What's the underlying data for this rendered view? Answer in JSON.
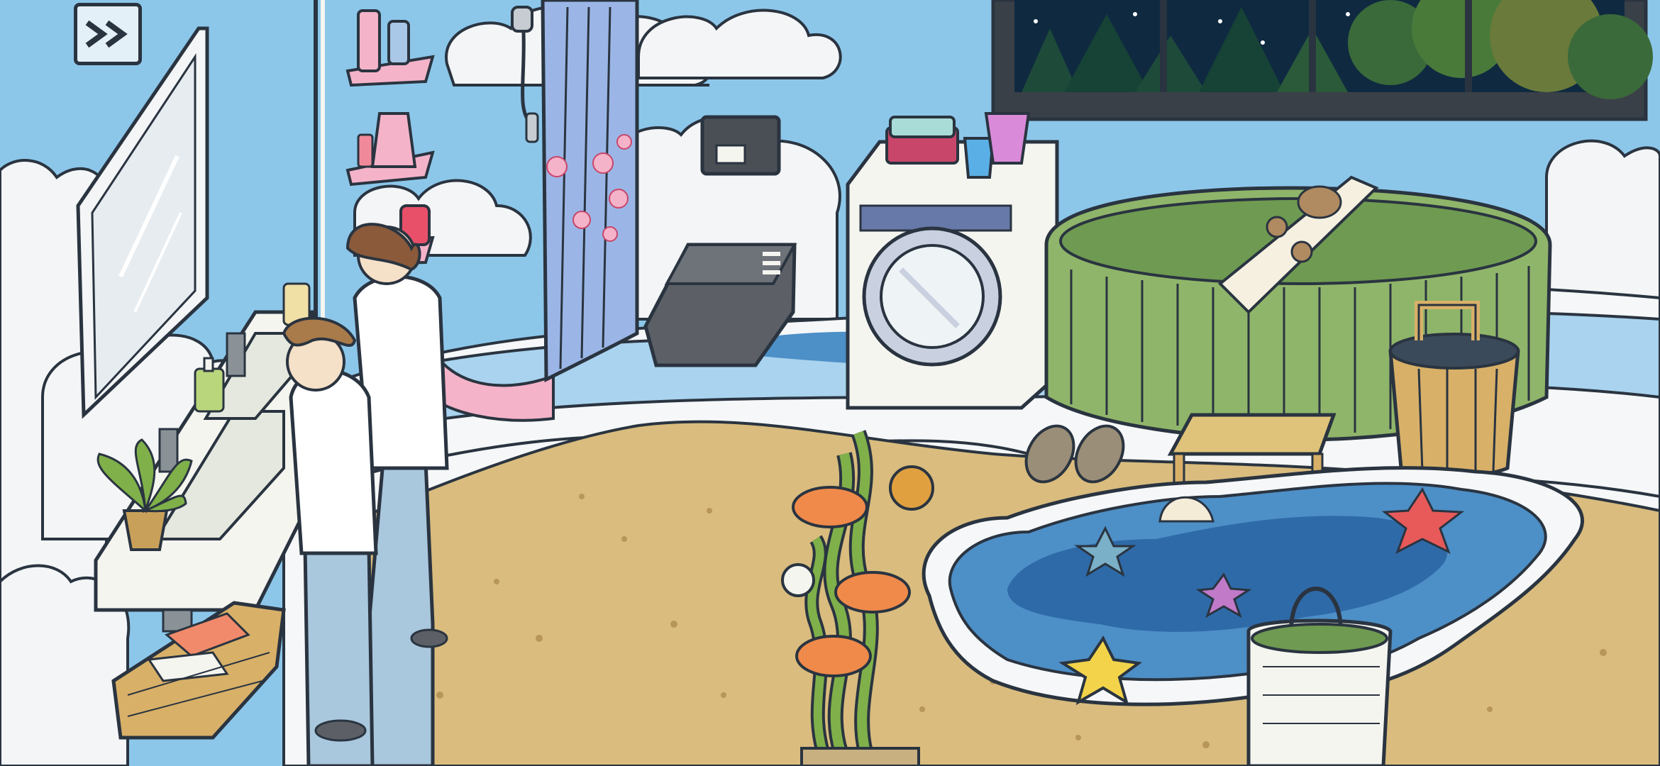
{
  "hud": {
    "skip_button": {
      "icon": "fast-forward-icon",
      "label": ""
    }
  },
  "palette": {
    "wall": "#8cc7ea",
    "outline": "#2a3440",
    "cloud": "#f3f5f6",
    "sand": "#d9bc7e",
    "sand_dark": "#b8965a",
    "wave_light": "#a9d3ee",
    "wave_mid": "#4d8fc7",
    "wave_deep": "#2f6aa8",
    "tub_green": "#8fb56a",
    "tub_green_dark": "#6f9a52",
    "shirt": "#ffffff",
    "pajama": "#a9c7dd",
    "hair": "#8a5a3a",
    "curtain": "#9bb6e6",
    "blossom": "#f4b3c9",
    "night_sky": "#0f2a40"
  }
}
